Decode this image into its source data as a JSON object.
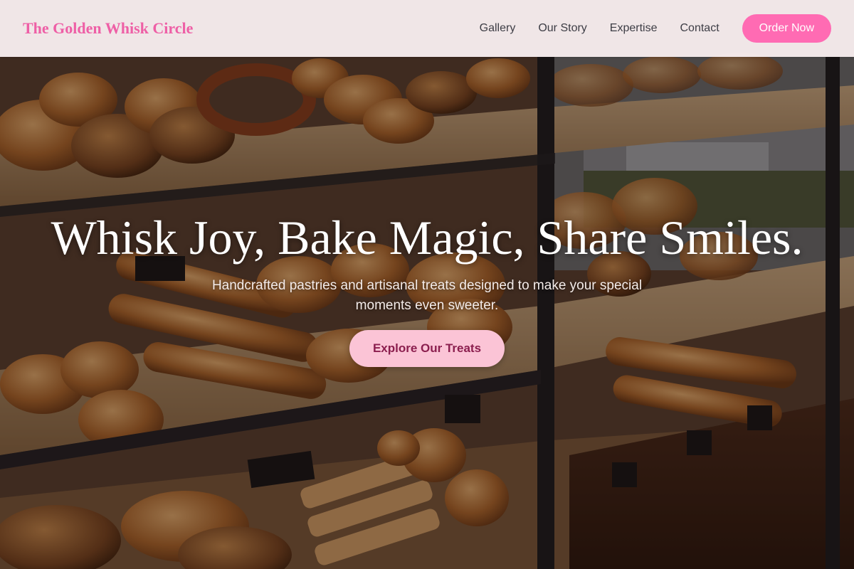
{
  "header": {
    "brand": "The Golden Whisk Circle",
    "nav": [
      "Gallery",
      "Our Story",
      "Expertise",
      "Contact"
    ],
    "cta_label": "Order Now"
  },
  "hero": {
    "title": "Whisk Joy, Bake Magic, Share Smiles.",
    "subtitle": "Handcrafted pastries and artisanal treats designed to make your special moments even sweeter.",
    "cta_label": "Explore Our Treats",
    "background_image": "bakery-display-case-photo"
  },
  "colors": {
    "brand": "#ee5fa6",
    "order_button": "#ff6bb3",
    "cta_button": "#fbc4d6",
    "cta_text": "#8b1e4e",
    "header_bg": "#faf0f2"
  }
}
